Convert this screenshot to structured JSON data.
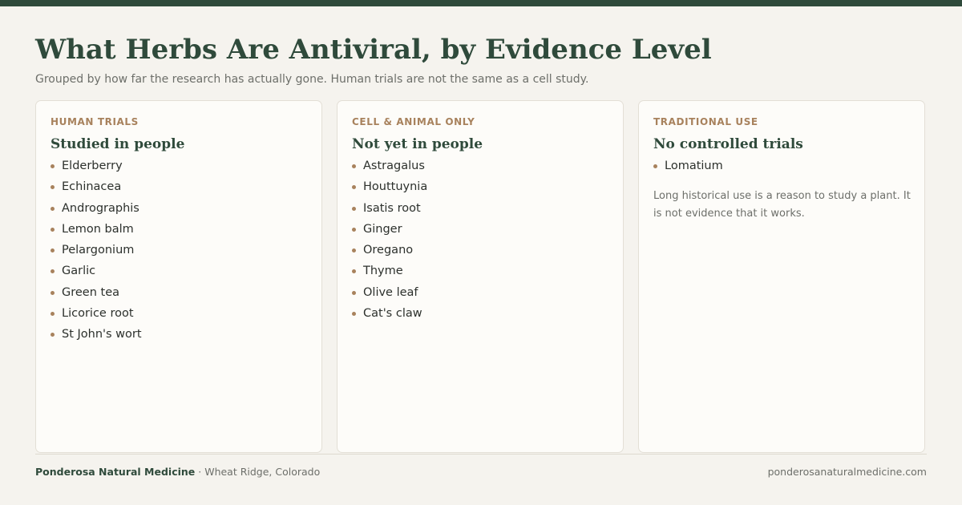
{
  "colors": {
    "brand_green": "#2f4a3b",
    "accent_tan": "#a8825d",
    "background": "#f5f3ee",
    "card_background": "#fdfcf9",
    "muted_text": "#6d6f6a"
  },
  "header": {
    "title": "What Herbs Are Antiviral, by Evidence Level",
    "subtitle": "Grouped by how far the research has actually gone. Human trials are not the same as a cell study."
  },
  "cards": [
    {
      "eyebrow": "HUMAN TRIALS",
      "heading": "Studied in people",
      "items": [
        "Elderberry",
        "Echinacea",
        "Andrographis",
        "Lemon balm",
        "Pelargonium",
        "Garlic",
        "Green tea",
        "Licorice root",
        "St John's wort"
      ]
    },
    {
      "eyebrow": "CELL & ANIMAL ONLY",
      "heading": "Not yet in people",
      "items": [
        "Astragalus",
        "Houttuynia",
        "Isatis root",
        "Ginger",
        "Oregano",
        "Thyme",
        "Olive leaf",
        "Cat's claw"
      ]
    },
    {
      "eyebrow": "TRADITIONAL USE",
      "heading": "No controlled trials",
      "items": [
        "Lomatium"
      ],
      "note": "Long historical use is a reason to study a plant. It is not evidence that it works."
    }
  ],
  "footer": {
    "brand": "Ponderosa Natural Medicine",
    "separator": " · ",
    "location": "Wheat Ridge, Colorado",
    "url": "ponderosanaturalmedicine.com"
  }
}
